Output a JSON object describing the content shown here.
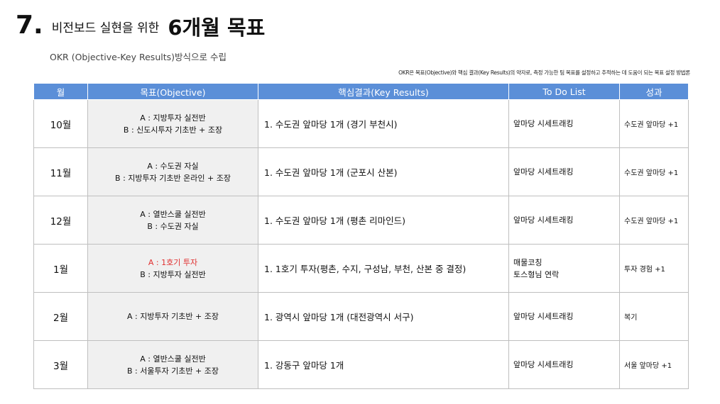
{
  "header": {
    "number": "7.",
    "title_small": "비전보드 실현을 위한",
    "title_big": "6개월 목표",
    "subtitle": "OKR (Objective-Key Results)방식으로 수립",
    "note": "OKR은 목표(Objective)와 핵심 결과(Key Results)의 약자로, 측정 가능한 팀 목표를 설정하고 추적하는 데 도움이 되는 목표 설정 방법론"
  },
  "table": {
    "headers": [
      "월",
      "목표(Objective)",
      "핵심결과(Key Results)",
      "To Do List",
      "성과"
    ],
    "rows": [
      {
        "month": "10월",
        "objective": [
          "A : 지방투자 실전반",
          "B : 신도시투자 기초반 + 조장"
        ],
        "key_result": "1.  수도권 앞마당 1개 (경기 부천시)",
        "todo": [
          "앞마당 시세트래킹"
        ],
        "result": "수도권 앞마당 +1"
      },
      {
        "month": "11월",
        "objective": [
          "A : 수도권 자실",
          "B : 지방투자 기초반 온라인 + 조장"
        ],
        "key_result": "1.  수도권 앞마당 1개 (군포시 산본)",
        "todo": [
          "앞마당 시세트래킹"
        ],
        "result": "수도권 앞마당 +1"
      },
      {
        "month": "12월",
        "objective": [
          "A : 열반스쿨 실전반",
          "B : 수도권 자실"
        ],
        "key_result": "1.  수도권 앞마당 1개 (평촌 리마인드)",
        "todo": [
          "앞마당 시세트래킹"
        ],
        "result": "수도권 앞마당 +1"
      },
      {
        "month": "1월",
        "objective": [
          "A : 1호기 투자",
          "B : 지방투자 실전반"
        ],
        "key_result": "1.  1호기 투자(평촌, 수지, 구성남, 부천, 산본 중 결정)",
        "todo": [
          "매물코칭",
          "토스형님 연락"
        ],
        "result": "투자 경험 +1"
      },
      {
        "month": "2월",
        "objective": [
          "A : 지방투자 기초반 + 조장"
        ],
        "key_result": "1.  광역시 앞마당 1개 (대전광역시 서구)",
        "todo": [
          "앞마당 시세트래킹"
        ],
        "result": "복기"
      },
      {
        "month": "3월",
        "objective": [
          "A : 열반스쿨 실전반",
          "B : 서울투자 기초반 + 조장"
        ],
        "key_result": "1.  강동구 앞마당 1개",
        "todo": [
          "앞마당 시세트래킹"
        ],
        "result": "서울 앞마당 +1"
      }
    ]
  },
  "colors": {
    "header_bg": "#5b8fd8",
    "objective_bg": "#f0f0f0",
    "highlight": "#e03030"
  }
}
